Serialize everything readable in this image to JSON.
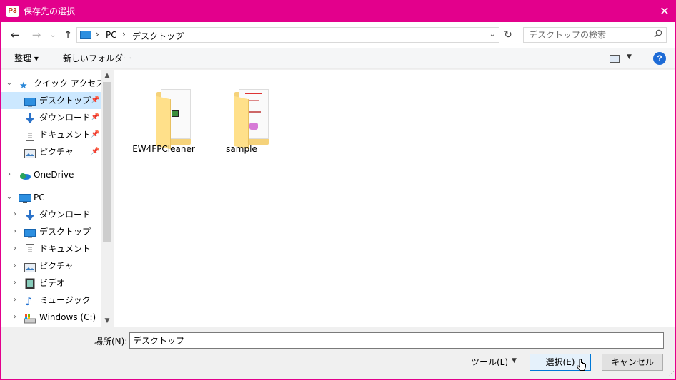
{
  "titlebar": {
    "app_icon_text": "P3",
    "title": "保存先の選択",
    "close_icon": "close-icon"
  },
  "nav": {
    "back_icon": "←",
    "forward_icon": "→",
    "recent_icon": "⌄",
    "up_icon": "↑",
    "breadcrumb": [
      "PC",
      "デスクトップ"
    ],
    "refresh_icon": "↻",
    "search_placeholder": "デスクトップの検索"
  },
  "toolbar": {
    "organize_label": "整理 ▾",
    "new_folder_label": "新しいフォルダー",
    "help_label": "?"
  },
  "sidebar": {
    "quick_access": {
      "label": "クイック アクセス",
      "items": [
        {
          "label": "デスクトップ",
          "icon": "desktop-icon",
          "pinned": true,
          "selected": true
        },
        {
          "label": "ダウンロード",
          "icon": "download-icon",
          "pinned": true
        },
        {
          "label": "ドキュメント",
          "icon": "document-icon",
          "pinned": true
        },
        {
          "label": "ピクチャ",
          "icon": "pictures-icon",
          "pinned": true
        }
      ]
    },
    "onedrive": {
      "label": "OneDrive",
      "icon": "onedrive-icon"
    },
    "pc": {
      "label": "PC",
      "items": [
        {
          "label": "ダウンロード",
          "icon": "download-icon"
        },
        {
          "label": "デスクトップ",
          "icon": "desktop-icon"
        },
        {
          "label": "ドキュメント",
          "icon": "document-icon"
        },
        {
          "label": "ピクチャ",
          "icon": "pictures-icon"
        },
        {
          "label": "ビデオ",
          "icon": "video-icon"
        },
        {
          "label": "ミュージック",
          "icon": "music-icon"
        },
        {
          "label": "Windows (C:)",
          "icon": "drive-icon"
        }
      ]
    }
  },
  "content": {
    "items": [
      {
        "name": "EW4FPCleaner",
        "type": "folder"
      },
      {
        "name": "sample",
        "type": "folder"
      }
    ]
  },
  "bottom": {
    "location_label": "場所(N):",
    "location_value": "デスクトップ",
    "tools_label": "ツール(L)",
    "select_label": "選択(E)",
    "cancel_label": "キャンセル"
  },
  "colors": {
    "accent": "#e3008c",
    "selection": "#cce8ff",
    "help": "#1d6bd6"
  }
}
